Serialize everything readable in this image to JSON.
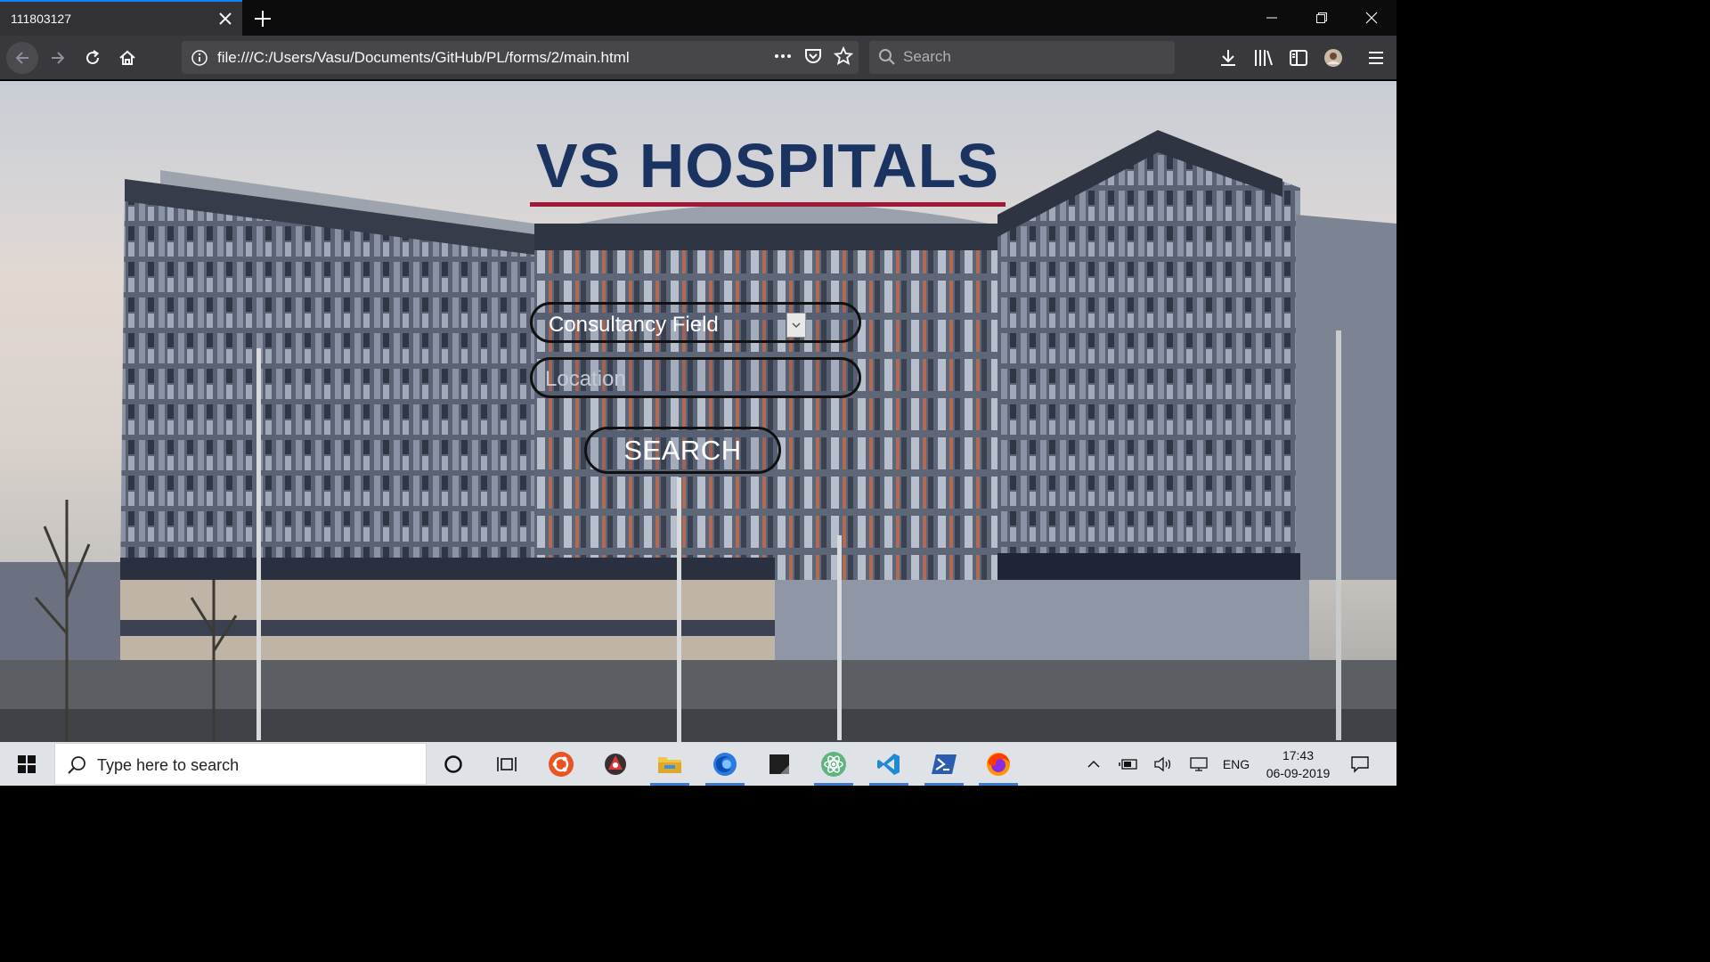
{
  "browser": {
    "tab_title": "111803127",
    "url": "file:///C:/Users/Vasu/Documents/GitHub/PL/forms/2/main.html",
    "search_placeholder": "Search",
    "icons": [
      "back-icon",
      "forward-icon",
      "reload-icon",
      "home-icon",
      "info-icon",
      "page-actions-icon",
      "pocket-icon",
      "bookmark-star-icon",
      "search-icon",
      "download-icon",
      "library-icon",
      "sidebar-icon",
      "account-avatar-icon",
      "menu-icon"
    ]
  },
  "page": {
    "title": "VS HOSPITALS",
    "consultancy_select": "Consultancy Field",
    "location_placeholder": "Location",
    "search_button": "SEARCH",
    "colors": {
      "title": "#1a3361",
      "underline": "#a0193a"
    }
  },
  "taskbar": {
    "search_placeholder": "Type here to search",
    "apps": [
      "cortana-icon",
      "task-view-icon",
      "ubuntu-icon",
      "app-red-icon",
      "file-explorer-icon",
      "firefox-dev-icon",
      "sticky-app-icon",
      "atom-icon",
      "vscode-icon",
      "powershell-icon",
      "firefox-icon"
    ],
    "language": "ENG",
    "time": "17:43",
    "date": "06-09-2019"
  }
}
